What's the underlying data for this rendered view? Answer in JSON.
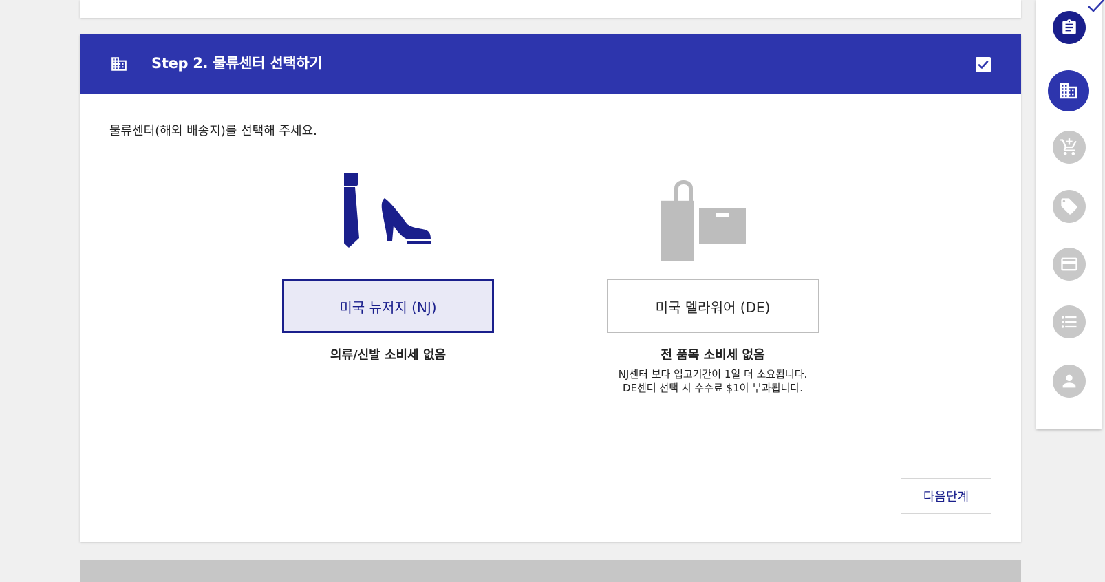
{
  "step": {
    "title": "Step 2. 물류센터 선택하기",
    "icon": "building-icon",
    "completed": true
  },
  "instruction": "물류센터(해외 배송지)를 선택해 주세요.",
  "options": [
    {
      "label": "미국 뉴저지 (NJ)",
      "selected": true,
      "icon": "tie-and-heel-icon",
      "note": "의류/신발 소비세 없음"
    },
    {
      "label": "미국 델라워어 (DE)",
      "selected": false,
      "icon": "bag-and-box-icon",
      "note": "전 품목 소비세 없음",
      "sub_lines": [
        "NJ센터 보다 입고기간이 1일 더 소요됩니다.",
        "DE센터 선택 시 수수료 $1이 부과됩니다."
      ]
    }
  ],
  "next_button": "다음단계",
  "sidebar": {
    "steps": [
      {
        "icon": "clipboard-icon",
        "state": "done"
      },
      {
        "icon": "building-icon",
        "state": "active"
      },
      {
        "icon": "cart-add-icon",
        "state": "pending"
      },
      {
        "icon": "tag-icon",
        "state": "pending"
      },
      {
        "icon": "credit-card-icon",
        "state": "pending"
      },
      {
        "icon": "list-icon",
        "state": "pending"
      },
      {
        "icon": "person-icon",
        "state": "pending"
      }
    ]
  },
  "colors": {
    "primary": "#2d35ad",
    "dark_navy": "#1a1f8c",
    "selected_bg": "#e9e9f6",
    "inactive_gray": "#c8c8c8"
  }
}
